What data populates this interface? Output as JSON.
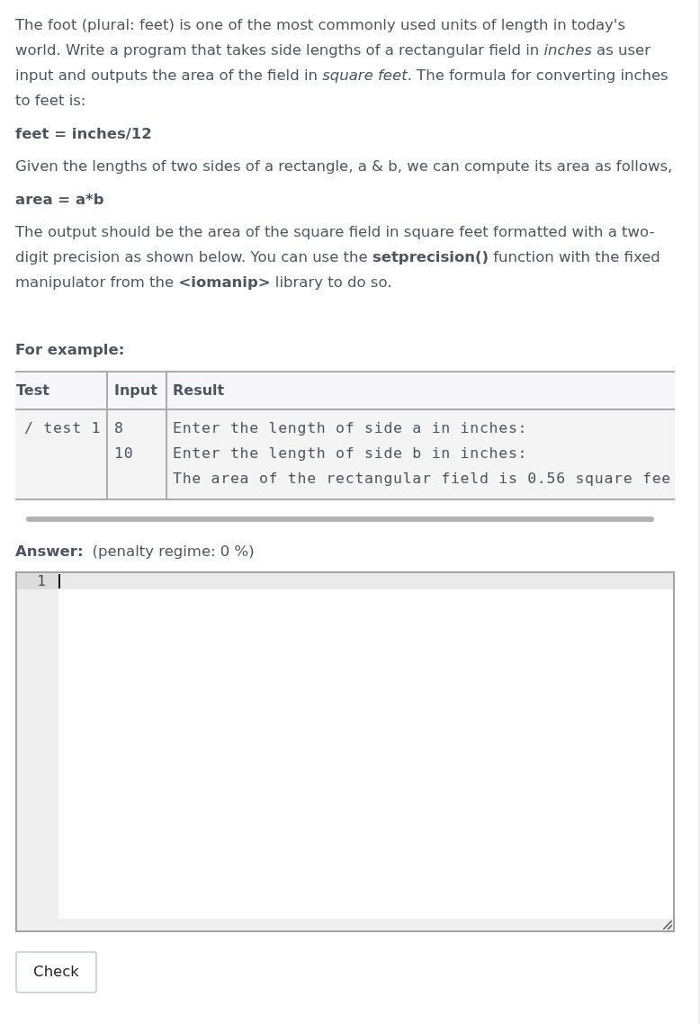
{
  "problem": {
    "paragraphs": [
      {
        "kind": "text",
        "text": "The foot (plural: feet) is one of the most commonly used units of length in today's world. Write a program that takes side lengths of a rectangular field in *inches* as user input and outputs the area of the field in *square feet*. The formula for converting inches to feet is:"
      },
      {
        "kind": "formula",
        "text": "feet = inches/12"
      },
      {
        "kind": "text",
        "text": "Given the lengths of two sides of a rectangle, a & b, we can compute its area as follows,"
      },
      {
        "kind": "formula",
        "text": "area = a*b"
      },
      {
        "kind": "text",
        "text": "The output should be the area of the square field in square feet formatted with a two-digit precision as shown below. You can use the **setprecision()** function with the fixed manipulator from the **<iomanip>** library to do so."
      }
    ]
  },
  "example": {
    "heading": "For example:",
    "table": {
      "columns": [
        "Test",
        "Input",
        "Result"
      ],
      "rows": [
        {
          "test": "/ test 1",
          "input": "8\n10",
          "result": "Enter the length of side a in inches:\nEnter the length of side b in inches:\nThe area of the rectangular field is 0.56 square fee"
        }
      ]
    }
  },
  "answer": {
    "label": "Answer:",
    "penalty": "(penalty regime: 0 %)",
    "editor": {
      "line_numbers": [
        "1"
      ]
    }
  },
  "check_button": {
    "label": "Check"
  }
}
